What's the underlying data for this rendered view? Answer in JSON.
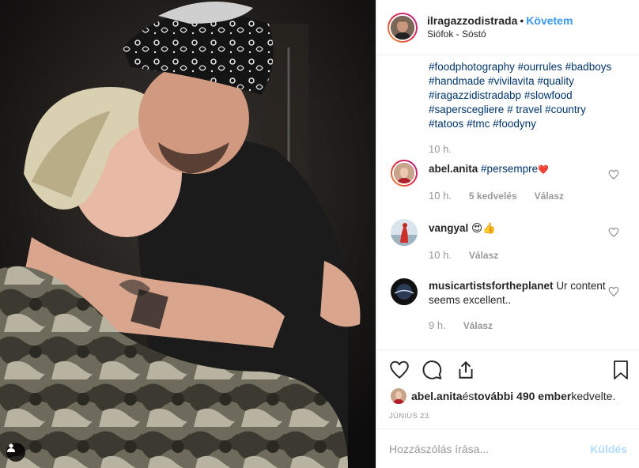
{
  "header": {
    "username": "ilragazzodistrada",
    "dot": "•",
    "follow_label": "Követem",
    "location": "Siófok - Sóstó"
  },
  "caption": {
    "hashtag_lines": [
      {
        "parts": [
          {
            "t": "#foodphotography",
            "tag": true
          },
          {
            "t": " ",
            "tag": false
          },
          {
            "t": "#ourrules",
            "tag": true
          },
          {
            "t": " ",
            "tag": false
          },
          {
            "t": "#badboys",
            "tag": true
          }
        ]
      },
      {
        "parts": [
          {
            "t": "#handmade",
            "tag": true
          },
          {
            "t": " ",
            "tag": false
          },
          {
            "t": "#vivilavita",
            "tag": true
          },
          {
            "t": " ",
            "tag": false
          },
          {
            "t": "#quality",
            "tag": true
          }
        ]
      },
      {
        "parts": [
          {
            "t": "#iragazzidistradabp",
            "tag": true
          },
          {
            "t": " ",
            "tag": false
          },
          {
            "t": "#slowfood",
            "tag": true
          }
        ]
      },
      {
        "parts": [
          {
            "t": "#saperscegliere",
            "tag": true
          },
          {
            "t": " # travel ",
            "tag": false
          },
          {
            "t": "#country",
            "tag": true
          }
        ]
      },
      {
        "parts": [
          {
            "t": "#tatoos",
            "tag": true
          },
          {
            "t": " ",
            "tag": false
          },
          {
            "t": "#tmc",
            "tag": true
          },
          {
            "t": " ",
            "tag": false
          },
          {
            "t": "#foodyny",
            "tag": true
          }
        ]
      }
    ],
    "time": "10 h."
  },
  "comments": [
    {
      "user": "abel.anita",
      "text": "#persempre",
      "emoji": "❤️",
      "time": "10 h.",
      "likes": "5 kedvelés",
      "reply": "Válasz"
    },
    {
      "user": "vangyal",
      "text": "",
      "emoji": "😍👍",
      "time": "10 h.",
      "likes": "",
      "reply": "Válasz"
    },
    {
      "user": "musicartistsfortheplanet",
      "text": "Ur content seems excellent..",
      "emoji": "",
      "time": "9 h.",
      "likes": "",
      "reply": "Válasz"
    }
  ],
  "likes_line": {
    "user": "abel.anita",
    "middle": " és ",
    "others": "további 490 ember",
    "suffix": " kedvelte."
  },
  "date": "JÚNIUS 23.",
  "add_comment": {
    "placeholder": "Hozzászólás írása...",
    "post_label": "Küldés"
  },
  "icons": [
    "heart-icon",
    "comment-icon",
    "share-icon",
    "bookmark-icon",
    "user-tag-icon"
  ],
  "colors": {
    "link": "#003569",
    "follow": "#3897f0",
    "muted": "#999999",
    "post_disabled": "#b3dbff"
  }
}
